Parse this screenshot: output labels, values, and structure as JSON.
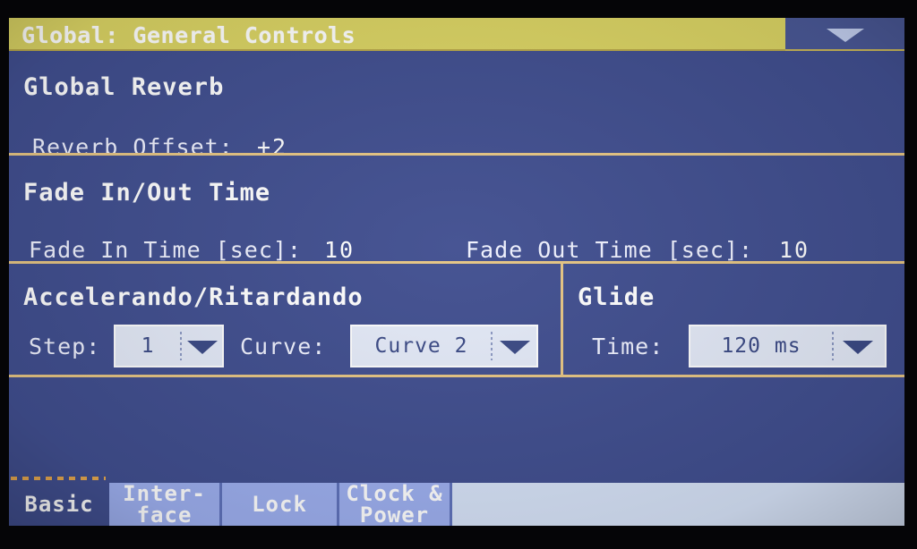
{
  "titlebar": {
    "title": "Global: General Controls",
    "page_menu_icon": "chevron-down-icon"
  },
  "sections": {
    "global_reverb": {
      "title": "Global Reverb",
      "reverb_offset_label": "Reverb Offset:",
      "reverb_offset_value": "+2"
    },
    "fade": {
      "title": "Fade In/Out Time",
      "fade_in_label": "Fade In Time [sec]:",
      "fade_in_value": "10",
      "fade_out_label": "Fade Out Time [sec]:",
      "fade_out_value": "10"
    },
    "accel_rit": {
      "title": "Accelerando/Ritardando",
      "step_label": "Step:",
      "step_value": "1",
      "curve_label": "Curve:",
      "curve_value": "Curve 2"
    },
    "glide": {
      "title": "Glide",
      "time_label": "Time:",
      "time_value": "120 ms"
    }
  },
  "tabs": [
    {
      "label": "Basic",
      "active": true
    },
    {
      "label": "Inter-\nface",
      "active": false
    },
    {
      "label": "Lock",
      "active": false
    },
    {
      "label": "Clock &\nPower",
      "active": false
    }
  ],
  "colors": {
    "background": "#414f90",
    "titlebar": "#dbd464",
    "divider": "#e7c684",
    "tab_inactive": "#9dafef",
    "tab_empty": "#d6e2f7",
    "dropdown_bg": "#e4eaf8",
    "dropdown_text": "#3b4a86",
    "marker": "#e8a94e"
  }
}
